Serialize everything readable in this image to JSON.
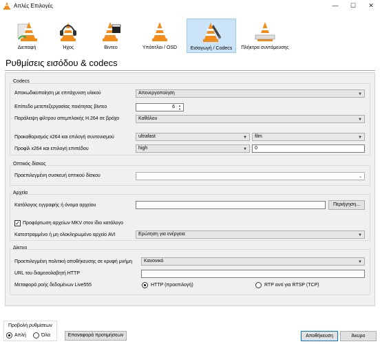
{
  "window": {
    "title": "Απλές Επιλογές",
    "minimize": "—",
    "maximize": "☐",
    "close": "✕"
  },
  "categories": [
    {
      "label": "Διεπαφή",
      "icon": "interface-cone-icon"
    },
    {
      "label": "Ήχος",
      "icon": "audio-headphones-cone-icon"
    },
    {
      "label": "Βίντεο",
      "icon": "video-clapper-cone-icon"
    },
    {
      "label": "Υπότιτλοι / OSD",
      "icon": "subtitles-cone-icon"
    },
    {
      "label": "Εισαγωγή / Codecs",
      "icon": "input-codecs-cone-icon"
    },
    {
      "label": "Πλήκτρα συντόμευσης",
      "icon": "hotkeys-cone-icon"
    }
  ],
  "selected_category": "Εισαγωγή / Codecs",
  "page_title": "Ρυθμίσεις εισόδου & codecs",
  "codecs": {
    "title": "Codecs",
    "hw_decoding_label": "Αποκωδικοποίηση με επιτάχυνση υλικού",
    "hw_decoding_value": "Απενεργοποίηση",
    "postproc_label": "Επίπεδο μετεπεξεργασίας ποιότητας βίντεο",
    "postproc_value": "6",
    "skip_loop_label": "Παράλειψη φίλτρου απεμπλοκής H.264 σε βρόχο",
    "skip_loop_value": "Καθόλου",
    "x264_preset_label": "Προκαθορισμός x264 και επιλογή συντονισμού",
    "x264_preset_value": "ultrafast",
    "x264_tune_value": "film",
    "x264_profile_label": "Προφίλ x264 και επιλογή επιπέδου",
    "x264_profile_value": "high",
    "x264_level_value": "0"
  },
  "disc": {
    "title": "Οπτικός δίσκος",
    "device_label": "Προεπιλεγμένη συσκευή οπτικού δίσκου",
    "device_value": ""
  },
  "files": {
    "title": "Αρχεία",
    "record_label": "Κατάλογος εγγραφής ή όνομα αρχείου",
    "record_value": "",
    "browse_label": "Περιήγηση...",
    "mkv_label": "Προφόρτωση αρχείων MKV στον ίδιο κατάλογο",
    "mkv_checked": true,
    "avi_label": "Κατεστραμμένο ή μη ολοκληρωμένο αρχείο AVI",
    "avi_value": "Ερώτηση για ενέργεια"
  },
  "network": {
    "title": "Δίκτυο",
    "cache_label": "Προεπιλεγμένη πολιτική αποθήκευσης σε κρυφή μνήμη",
    "cache_value": "Κανονικό",
    "proxy_label": "URL του διαμεσολαβητή HTTP",
    "proxy_value": "",
    "live555_label": "Μεταφορά ροής δεδομένων Live555",
    "http_option": "HTTP (προεπιλογή)",
    "rtp_option": "RTP αντί για RTSP (TCP)",
    "selected_transport": "HTTP (προεπιλογή)"
  },
  "footer": {
    "show_settings_label": "Προβολή ρυθμίσεων",
    "simple_label": "Απλή",
    "all_label": "Όλα",
    "selected_mode": "Απλή",
    "reset_label": "Επαναφορά προτιμήσεων",
    "save_label": "Αποθήκευση",
    "cancel_label": "Άκυρο"
  },
  "colors": {
    "accent_selected_bg": "#cce4f7",
    "accent_selected_border": "#99c9ef",
    "cone_orange": "#f28c1a",
    "primary_button_border": "#0078d7"
  }
}
